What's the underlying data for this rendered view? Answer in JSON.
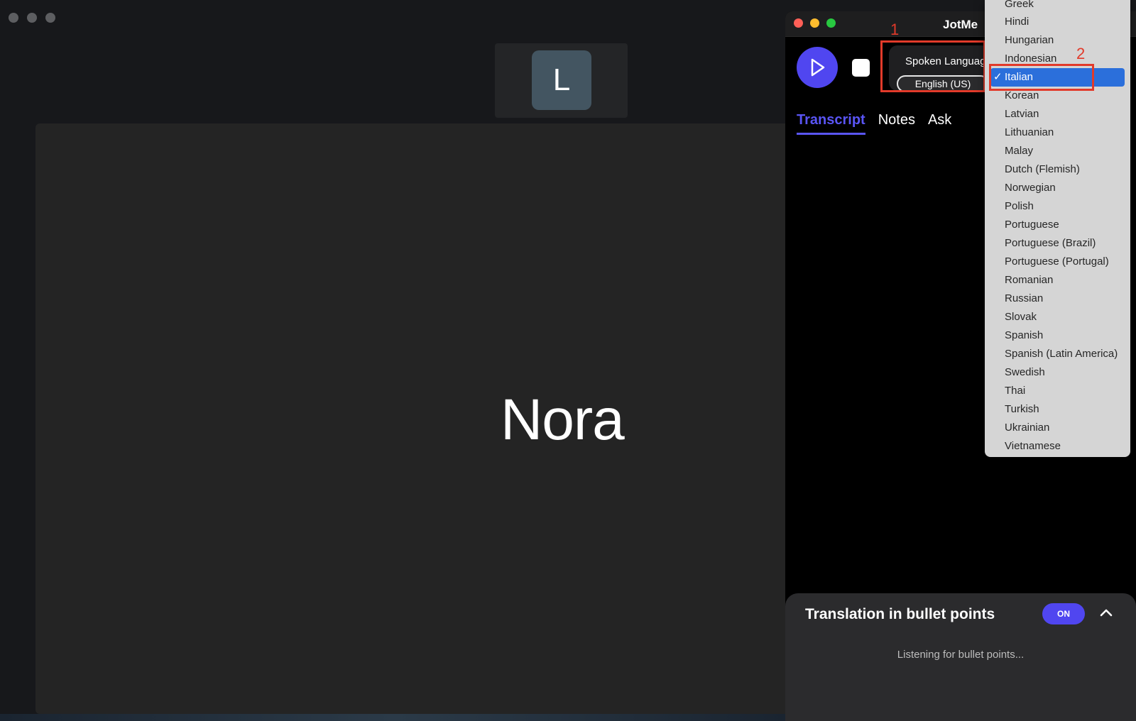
{
  "meeting": {
    "participant_initial": "L",
    "speaker_name": "Nora"
  },
  "jotme": {
    "title": "JotMe",
    "spoken_language_label": "Spoken Language",
    "spoken_language_value": "English (US)",
    "tabs": [
      {
        "label": "Transcript",
        "active": true
      },
      {
        "label": "Notes",
        "active": false
      },
      {
        "label": "Ask",
        "active": false
      }
    ],
    "bullet_panel": {
      "title": "Translation in bullet points",
      "toggle_label": "ON",
      "status": "Listening for bullet points..."
    }
  },
  "annotations": {
    "step1": "1",
    "step2": "2"
  },
  "language_menu": {
    "selected": "Italian",
    "items": [
      "Greek",
      "Hindi",
      "Hungarian",
      "Indonesian",
      "Italian",
      "Korean",
      "Latvian",
      "Lithuanian",
      "Malay",
      "Dutch (Flemish)",
      "Norwegian",
      "Polish",
      "Portuguese",
      "Portuguese (Brazil)",
      "Portuguese (Portugal)",
      "Romanian",
      "Russian",
      "Slovak",
      "Spanish",
      "Spanish (Latin America)",
      "Swedish",
      "Thai",
      "Turkish",
      "Ukrainian",
      "Vietnamese"
    ]
  },
  "colors": {
    "accent": "#5046f0",
    "annotation": "#e23a2a",
    "menu_highlight": "#2b6fdb"
  }
}
